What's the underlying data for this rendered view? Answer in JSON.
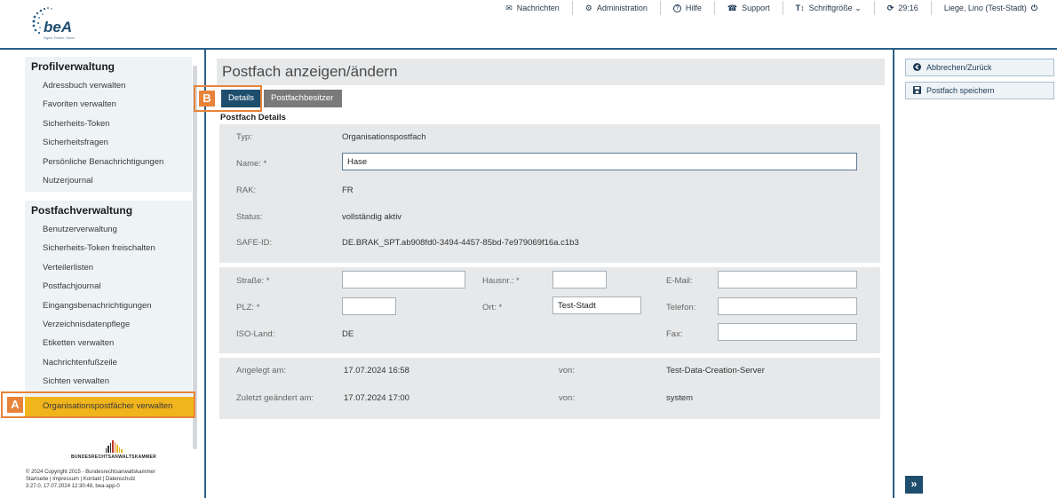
{
  "header": {
    "logo": {
      "text": "beA",
      "tagline": "Digital. Einfach. Sicher."
    },
    "nav": [
      {
        "icon": "envelope-icon",
        "glyph": "✉",
        "label": "Nachrichten"
      },
      {
        "icon": "users-gear-icon",
        "glyph": "⚙",
        "label": "Administration"
      },
      {
        "icon": "help-icon",
        "glyph": "?",
        "label": "Hilfe"
      },
      {
        "icon": "support-icon",
        "glyph": "☎",
        "label": "Support"
      },
      {
        "icon": "font-size-icon",
        "glyph": "T↕",
        "label": "Schriftgröße ⌄"
      },
      {
        "icon": "refresh-icon",
        "glyph": "⟳",
        "label": "29:16"
      },
      {
        "icon": "power-icon",
        "glyph": "⏻",
        "label": "Liege, Lino (Test-Stadt)"
      }
    ]
  },
  "sidebar": {
    "profile": {
      "title": "Profilverwaltung",
      "items": [
        "Adressbuch verwalten",
        "Favoriten verwalten",
        "Sicherheits-Token",
        "Sicherheitsfragen",
        "Persönliche Benachrichtigungen",
        "Nutzerjournal"
      ]
    },
    "mailbox": {
      "title": "Postfachverwaltung",
      "items": [
        "Benutzerverwaltung",
        "Sicherheits-Token freischalten",
        "Verteilerlisten",
        "Postfachjournal",
        "Eingangsbenachrichtigungen",
        "Verzeichnisdatenpflege",
        "Etiketten verwalten",
        "Nachrichtenfußzeile",
        "Sichten verwalten"
      ],
      "active_item": "Organisationspostfächer verwalten"
    },
    "callout": "A",
    "brak_label": "BUNDESRECHTSANWALTSKAMMER",
    "footer": {
      "line1": "© 2024 Copyright 2015 - Bundesrechtsanwaltskammer",
      "line2": "Startseite | Impressum | Kontakt | Datenschutz",
      "line3": "3.27.0, 17.07.2024 12:30:48, bea-app-0"
    }
  },
  "main": {
    "title": "Postfach anzeigen/ändern",
    "tabs": {
      "details": "Details",
      "owner": "Postfachbesitzer"
    },
    "callout": "B",
    "section_title": "Postfach Details",
    "details": {
      "type_label": "Typ:",
      "type_value": "Organisationspostfach",
      "name_label": "Name: *",
      "name_value": "Hase",
      "rak_label": "RAK:",
      "rak_value": "FR",
      "status_label": "Status:",
      "status_value": "vollständig aktiv",
      "safe_label": "SAFE-ID:",
      "safe_value": "DE.BRAK_SPT.ab908fd0-3494-4457-85bd-7e979069f16a.c1b3"
    },
    "address": {
      "street_label": "Straße: *",
      "street_value": "",
      "houseno_label": "Hausnr.: *",
      "houseno_value": "",
      "email_label": "E-Mail:",
      "email_value": "",
      "zip_label": "PLZ: *",
      "zip_value": "",
      "city_label": "Ort: *",
      "city_value": "Test-Stadt",
      "phone_label": "Telefon:",
      "phone_value": "",
      "country_label": "ISO-Land:",
      "country_value": "DE",
      "fax_label": "Fax:",
      "fax_value": ""
    },
    "meta": {
      "created_label": "Angelegt am:",
      "created_value": "17.07.2024 16:58",
      "created_by_label": "von:",
      "created_by_value": "Test-Data-Creation-Server",
      "changed_label": "Zuletzt geändert am:",
      "changed_value": "17.07.2024 17:00",
      "changed_by_label": "von:",
      "changed_by_value": "system"
    }
  },
  "right": {
    "back_label": "Abbrechen/Zurück",
    "save_label": "Postfach speichern",
    "expand_label": "»"
  },
  "colors": {
    "accent": "#1e4d6e",
    "highlight": "#f0b41c",
    "callout": "#e8833a",
    "border": "#2d5f86"
  }
}
